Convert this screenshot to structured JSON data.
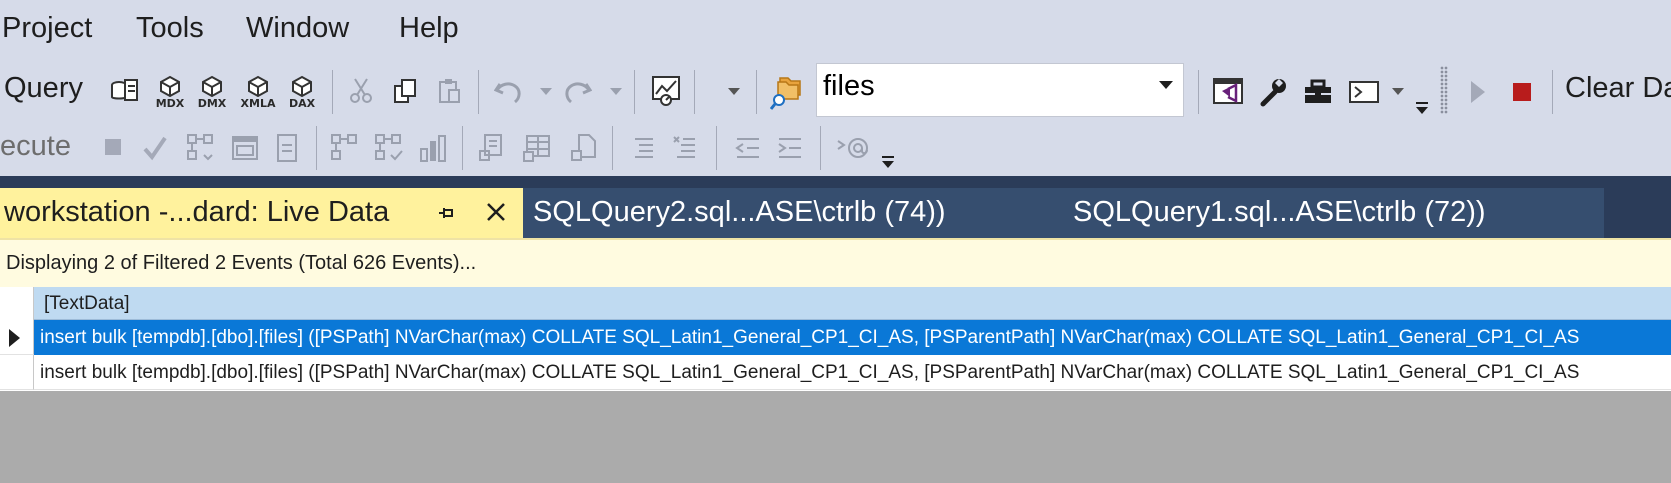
{
  "menu": {
    "items": [
      "Project",
      "Tools",
      "Window",
      "Help"
    ]
  },
  "toolbar1": {
    "query_label": "Query",
    "mdx_label": "MDX",
    "dmx_label": "DMX",
    "xmla_label": "XMLA",
    "dax_label": "DAX",
    "database_combo_value": "files",
    "clear_data_label": "Clear Da"
  },
  "toolbar2": {
    "execute_label": "ecute"
  },
  "tabs": [
    {
      "label": "workstation -...dard: Live Data",
      "active": true
    },
    {
      "label": "SQLQuery2.sql...ASE\\ctrlb (74))",
      "active": false
    },
    {
      "label": "SQLQuery1.sql...ASE\\ctrlb (72))",
      "active": false
    }
  ],
  "status": {
    "events_text": "Displaying 2 of Filtered 2 Events (Total 626 Events)..."
  },
  "grid": {
    "columns": [
      "[TextData]"
    ],
    "rows": [
      "insert bulk [tempdb].[dbo].[files] ([PSPath] NVarChar(max) COLLATE SQL_Latin1_General_CP1_CI_AS, [PSParentPath] NVarChar(max) COLLATE SQL_Latin1_General_CP1_CI_AS",
      "insert bulk [tempdb].[dbo].[files] ([PSPath] NVarChar(max) COLLATE SQL_Latin1_General_CP1_CI_AS, [PSParentPath] NVarChar(max) COLLATE SQL_Latin1_General_CP1_CI_AS"
    ],
    "selected_row": 1
  },
  "colors": {
    "chrome": "#d6dbe9",
    "tab_strip": "#2b3c59",
    "active_tab": "#fff29d",
    "selection": "#0a78d7",
    "stop_red": "#b81c1c",
    "vs_purple": "#68217a"
  }
}
